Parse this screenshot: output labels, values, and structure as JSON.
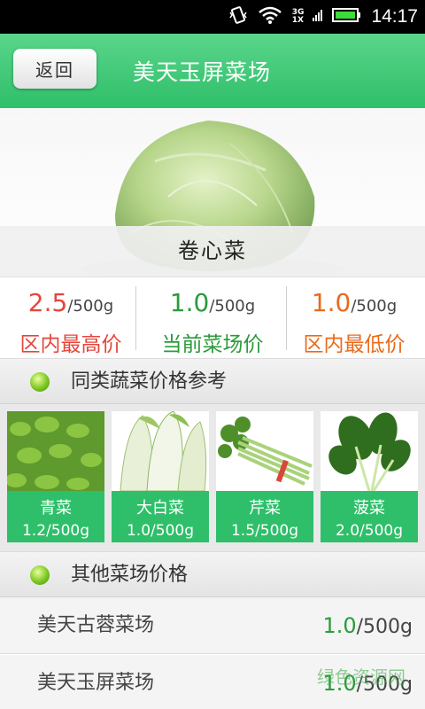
{
  "status_bar": {
    "net_top": "3G",
    "net_bottom": "1X",
    "time": "14:17",
    "icons": [
      "vibrate-icon",
      "wifi-icon",
      "signal-icon",
      "battery-icon"
    ]
  },
  "header": {
    "back_label": "返回",
    "title": "美天玉屏菜场"
  },
  "product": {
    "name": "卷心菜"
  },
  "prices": [
    {
      "value": "2.5",
      "unit": "/500g",
      "label": "区内最高价",
      "color": "#e5463c"
    },
    {
      "value": "1.0",
      "unit": "/500g",
      "label": "当前菜场价",
      "color": "#2a9b3c"
    },
    {
      "value": "1.0",
      "unit": "/500g",
      "label": "区内最低价",
      "color": "#ea6a1c"
    }
  ],
  "similar": {
    "title": "同类蔬菜价格参考",
    "items": [
      {
        "name": "青菜",
        "price": "1.2/500g"
      },
      {
        "name": "大白菜",
        "price": "1.0/500g"
      },
      {
        "name": "芹菜",
        "price": "1.5/500g"
      },
      {
        "name": "菠菜",
        "price": "2.0/500g"
      }
    ]
  },
  "others": {
    "title": "其他菜场价格",
    "rows": [
      {
        "name": "美天古蓉菜场",
        "value": "1.0",
        "unit": "/500g"
      },
      {
        "name": "美天玉屏菜场",
        "value": "1.0",
        "unit": "/500g"
      }
    ]
  },
  "watermark": "绿色资源网",
  "colors": {
    "header_green": "#2fbf6a",
    "price_green": "#2a9b3c"
  }
}
